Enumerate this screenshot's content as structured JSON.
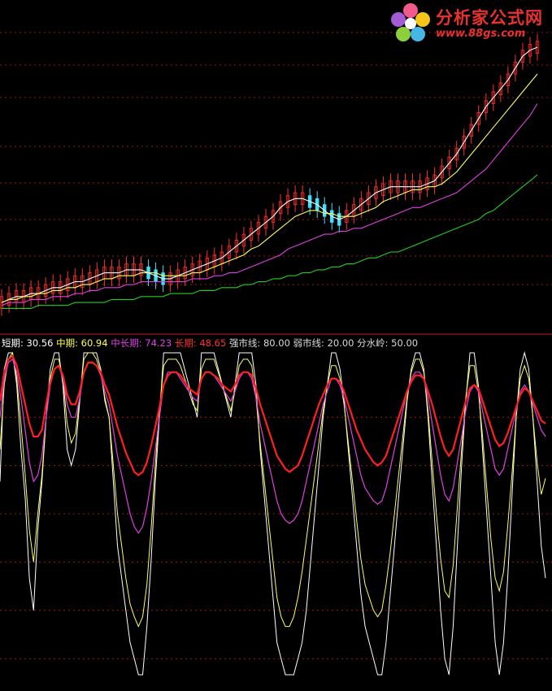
{
  "logo": {
    "text": "分析家公式网",
    "url": "www.88gs.com",
    "icon": "flower-logo-icon"
  },
  "colors": {
    "background": "#000000",
    "up": "#ff3030",
    "down": "#40e0ff",
    "ma_short": "#ffffff",
    "ma_mid": "#ffff60",
    "ma_long": "#e040e0",
    "ma_longest": "#20d020",
    "grid": "#9a1a1a",
    "divider": "#c81e1e",
    "osc_short": "#ffffff",
    "osc_mid": "#ffff60",
    "osc_midlong": "#e040e0",
    "osc_long": "#ff2020",
    "label": "#d8d8d8"
  },
  "legend": [
    {
      "label": "短期:",
      "value": "30.56",
      "color": "#ffffff"
    },
    {
      "label": "中期:",
      "value": "60.94",
      "color": "#ffff60"
    },
    {
      "label": "中长期:",
      "value": "74.23",
      "color": "#e040e0"
    },
    {
      "label": "长期:",
      "value": "48.65",
      "color": "#ff3030"
    },
    {
      "label": "强市线:",
      "value": "80.00",
      "color": "#d8d8d8"
    },
    {
      "label": "弱市线:",
      "value": "20.00",
      "color": "#d8d8d8"
    },
    {
      "label": "分水岭:",
      "value": "50.00",
      "color": "#d8d8d8"
    }
  ],
  "chart_data": [
    {
      "type": "candlestick",
      "bars": 130,
      "ylim": [
        0,
        100
      ],
      "grid": "dashed",
      "series": [
        {
          "values": [
            3,
            4,
            5,
            5,
            6,
            6,
            7,
            8,
            8,
            9,
            10,
            10,
            11,
            12,
            13,
            13,
            13,
            14,
            14,
            14,
            13,
            12,
            11,
            11,
            12,
            13,
            14,
            15,
            16,
            17,
            18,
            20,
            22,
            24,
            26,
            28,
            30,
            32,
            35,
            37,
            38,
            38,
            37,
            36,
            34,
            32,
            31,
            32,
            34,
            36,
            38,
            40,
            41,
            42,
            42,
            42,
            42,
            42,
            43,
            44,
            47,
            50,
            53,
            57,
            61,
            65,
            69,
            72,
            75,
            78,
            82,
            86,
            88,
            89
          ]
        },
        {
          "values": [
            3,
            4,
            4,
            5,
            5,
            6,
            6,
            7,
            7,
            8,
            8,
            9,
            9,
            10,
            11,
            11,
            12,
            12,
            12,
            13,
            13,
            13,
            12,
            12,
            12,
            12,
            13,
            13,
            14,
            15,
            16,
            17,
            18,
            19,
            21,
            22,
            24,
            26,
            28,
            30,
            32,
            33,
            34,
            34,
            33,
            33,
            32,
            32,
            32,
            33,
            34,
            35,
            37,
            38,
            39,
            40,
            41,
            41,
            42,
            42,
            43,
            45,
            47,
            50,
            53,
            56,
            59,
            62,
            65,
            68,
            71,
            74,
            77,
            80
          ]
        },
        {
          "values": [
            2,
            3,
            3,
            3,
            4,
            4,
            4,
            5,
            5,
            5,
            6,
            6,
            7,
            7,
            8,
            8,
            8,
            9,
            9,
            10,
            10,
            10,
            10,
            10,
            10,
            10,
            11,
            11,
            11,
            12,
            12,
            13,
            13,
            14,
            15,
            16,
            17,
            18,
            19,
            21,
            22,
            23,
            24,
            25,
            26,
            26,
            27,
            27,
            28,
            28,
            29,
            30,
            31,
            32,
            33,
            34,
            35,
            35,
            36,
            37,
            38,
            39,
            40,
            42,
            44,
            46,
            48,
            51,
            54,
            57,
            60,
            63,
            66,
            70
          ]
        },
        {
          "values": [
            1,
            1,
            1,
            1,
            1,
            2,
            2,
            2,
            2,
            2,
            3,
            3,
            3,
            3,
            3,
            4,
            4,
            4,
            4,
            5,
            5,
            5,
            5,
            6,
            6,
            6,
            6,
            7,
            7,
            7,
            8,
            8,
            8,
            9,
            9,
            10,
            10,
            11,
            11,
            12,
            12,
            13,
            13,
            14,
            14,
            15,
            15,
            16,
            16,
            17,
            18,
            18,
            19,
            20,
            20,
            21,
            22,
            23,
            24,
            25,
            26,
            27,
            28,
            29,
            30,
            31,
            33,
            34,
            36,
            38,
            40,
            42,
            44,
            46
          ]
        }
      ]
    },
    {
      "type": "line",
      "ylim": [
        0,
        100
      ],
      "reference_lines": [
        80,
        50,
        20
      ],
      "series": [
        {
          "name": "短期",
          "values": [
            60,
            95,
            100,
            100,
            90,
            70,
            55,
            30,
            20,
            45,
            60,
            80,
            95,
            100,
            100,
            90,
            70,
            65,
            70,
            85,
            100,
            100,
            100,
            100,
            95,
            85,
            80,
            60,
            40,
            30,
            20,
            10,
            5,
            0,
            0,
            15,
            35,
            60,
            80,
            100,
            100,
            100,
            100,
            100,
            95,
            90,
            85,
            80,
            100,
            100,
            100,
            100,
            95,
            90,
            85,
            80,
            90,
            100,
            100,
            100,
            100,
            90,
            70,
            55,
            40,
            25,
            10,
            5,
            0,
            0,
            0,
            5,
            10,
            20,
            35,
            50,
            65,
            80,
            90,
            100,
            100,
            95,
            85,
            70,
            55,
            40,
            25,
            15,
            10,
            5,
            0,
            0,
            10,
            25,
            40,
            55,
            70,
            85,
            95,
            100,
            100,
            95,
            80,
            60,
            40,
            20,
            5,
            0,
            15,
            40,
            65,
            85,
            100,
            100,
            90,
            70,
            50,
            30,
            10,
            0,
            10,
            30,
            55,
            80,
            95,
            100,
            95,
            80,
            60,
            40,
            30
          ]
        },
        {
          "name": "中期",
          "values": [
            70,
            90,
            98,
            100,
            92,
            78,
            62,
            45,
            35,
            50,
            62,
            80,
            92,
            98,
            98,
            92,
            78,
            72,
            75,
            86,
            98,
            100,
            100,
            98,
            94,
            86,
            80,
            65,
            50,
            40,
            30,
            22,
            18,
            15,
            18,
            28,
            45,
            65,
            82,
            96,
            98,
            98,
            98,
            96,
            92,
            88,
            84,
            82,
            95,
            98,
            98,
            98,
            94,
            90,
            86,
            82,
            88,
            96,
            98,
            98,
            96,
            86,
            72,
            60,
            48,
            36,
            24,
            18,
            15,
            15,
            18,
            24,
            32,
            42,
            52,
            62,
            72,
            82,
            90,
            96,
            96,
            92,
            84,
            72,
            60,
            48,
            36,
            28,
            24,
            20,
            18,
            20,
            28,
            38,
            50,
            62,
            74,
            86,
            94,
            98,
            98,
            94,
            82,
            66,
            50,
            36,
            26,
            24,
            34,
            52,
            70,
            86,
            96,
            96,
            88,
            74,
            58,
            42,
            30,
            26,
            32,
            46,
            62,
            80,
            92,
            96,
            92,
            80,
            66,
            56,
            61
          ]
        },
        {
          "name": "中长期",
          "values": [
            80,
            92,
            97,
            98,
            94,
            86,
            76,
            66,
            60,
            62,
            68,
            80,
            90,
            95,
            96,
            92,
            84,
            80,
            80,
            86,
            94,
            97,
            97,
            96,
            93,
            88,
            84,
            76,
            68,
            62,
            56,
            50,
            46,
            44,
            46,
            52,
            60,
            70,
            80,
            90,
            94,
            94,
            94,
            92,
            90,
            88,
            86,
            85,
            92,
            94,
            94,
            93,
            91,
            89,
            87,
            85,
            88,
            92,
            94,
            94,
            92,
            86,
            78,
            72,
            66,
            60,
            54,
            50,
            48,
            47,
            48,
            50,
            54,
            60,
            66,
            72,
            78,
            84,
            88,
            92,
            92,
            90,
            86,
            80,
            74,
            68,
            62,
            58,
            56,
            54,
            53,
            54,
            58,
            64,
            70,
            76,
            82,
            88,
            92,
            94,
            94,
            92,
            86,
            78,
            70,
            62,
            56,
            54,
            58,
            66,
            74,
            82,
            88,
            90,
            88,
            82,
            76,
            70,
            64,
            62,
            64,
            70,
            76,
            82,
            88,
            90,
            88,
            84,
            80,
            76,
            74
          ]
        },
        {
          "name": "长期",
          "values": [
            85,
            94,
            98,
            99,
            96,
            90,
            84,
            78,
            74,
            74,
            76,
            84,
            91,
            95,
            96,
            93,
            87,
            84,
            84,
            88,
            94,
            97,
            97,
            96,
            94,
            90,
            87,
            82,
            77,
            73,
            69,
            66,
            63,
            62,
            63,
            66,
            71,
            77,
            83,
            90,
            93,
            94,
            94,
            93,
            91,
            89,
            88,
            87,
            92,
            94,
            94,
            93,
            92,
            90,
            89,
            88,
            90,
            93,
            94,
            94,
            93,
            89,
            84,
            80,
            76,
            72,
            68,
            66,
            64,
            63,
            64,
            65,
            68,
            72,
            76,
            80,
            84,
            87,
            90,
            92,
            92,
            91,
            88,
            84,
            80,
            76,
            73,
            70,
            68,
            66,
            65,
            66,
            68,
            72,
            76,
            80,
            84,
            88,
            91,
            93,
            93,
            92,
            88,
            84,
            79,
            74,
            70,
            68,
            70,
            75,
            80,
            85,
            89,
            90,
            89,
            85,
            81,
            77,
            73,
            71,
            72,
            75,
            79,
            83,
            87,
            89,
            88,
            85,
            82,
            79,
            78
          ]
        }
      ]
    }
  ]
}
